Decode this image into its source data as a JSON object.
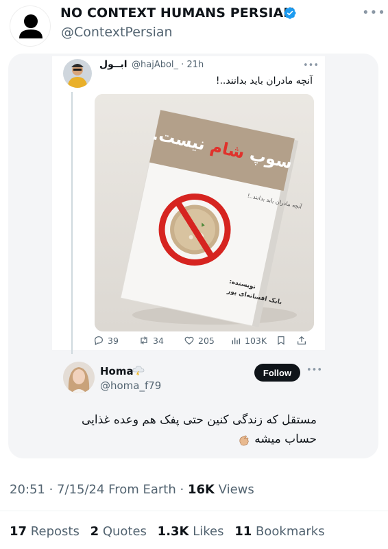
{
  "author": {
    "name": "NO CONTEXT HUMANS PERSIAN",
    "handle": "@ContextPersian",
    "verified_color": "#1d9bf0"
  },
  "quoted_tweet": {
    "name": "ابــول",
    "handle": "@hajAbol_",
    "time": "21h",
    "text": "آنچه مادران باید بدانند..!",
    "book": {
      "title_part1": "سوپ",
      "title_part2": "شام",
      "title_part3": "نیست.",
      "subtitle": "آنچه مادران باید بدانند..!",
      "author_label": "نویسنده:",
      "author_name": "بابک افسانه‌ای پور"
    },
    "actions": {
      "replies": "39",
      "retweets": "34",
      "likes": "205",
      "views": "103K"
    }
  },
  "reply_tweet": {
    "name": "Homa",
    "handle": "@homa_f79",
    "follow_label": "Follow",
    "text_line1": "مستقل که زندگی کنین حتی پفک هم وعده غذایی",
    "text_line2": "حساب میشه"
  },
  "meta": {
    "time": "20:51",
    "date": "7/15/24",
    "source": "From Earth",
    "views_value": "16K",
    "views_label": "Views"
  },
  "stats": {
    "reposts_value": "17",
    "reposts_label": "Reposts",
    "quotes_value": "2",
    "quotes_label": "Quotes",
    "likes_value": "1.3K",
    "likes_label": "Likes",
    "bookmarks_value": "11",
    "bookmarks_label": "Bookmarks"
  },
  "icons": {
    "more": "more-dots-icon",
    "reply": "reply-icon",
    "retweet": "retweet-icon",
    "like": "heart-icon",
    "views": "views-icon",
    "bookmark": "bookmark-icon",
    "share": "share-icon",
    "verified": "verified-badge-icon"
  }
}
